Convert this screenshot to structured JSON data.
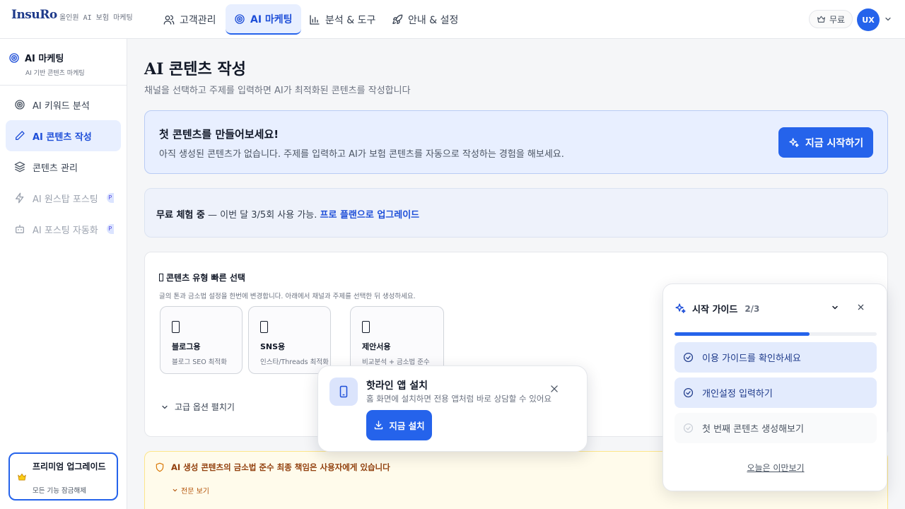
{
  "header": {
    "brand": "InsuRo",
    "brand_sub": "올인원 AI 보험 마케팅",
    "nav": [
      {
        "label": "고객관리"
      },
      {
        "label": "AI 마케팅"
      },
      {
        "label": "분석 & 도구"
      },
      {
        "label": "안내 & 설정"
      }
    ],
    "plan_label": "무료",
    "avatar_initials": "UX"
  },
  "sidebar": {
    "title": "AI 마케팅",
    "subtitle": "AI 기반 콘텐츠 마케팅",
    "items": [
      {
        "label": "AI 키워드 분석"
      },
      {
        "label": "AI 콘텐츠 작성"
      },
      {
        "label": "콘텐츠 관리"
      },
      {
        "label": "AI 원스탑 포스팅",
        "badge": "P"
      },
      {
        "label": "AI 포스팅 자동화",
        "badge": "P"
      }
    ],
    "upgrade": {
      "title": "프리미엄 업그레이드",
      "subtitle": "모든 기능 잠금해제"
    }
  },
  "main": {
    "title_ai": "AI",
    "title_rest": " 콘텐츠 작성",
    "subtitle": "채널을 선택하고 주제를 입력하면 AI가 최적화된 콘텐츠를 작성합니다",
    "hero": {
      "title": "첫 콘텐츠를 만들어보세요!",
      "desc": "아직 생성된 콘텐츠가 없습니다. 주제를 입력하고 AI가 보험 콘텐츠를 자동으로 작성하는 경험을 해보세요.",
      "button": "지금 시작하기"
    },
    "trial": {
      "bold": "무료 체험 중",
      "text": " — 이번 달 3/5회 사용 가능. ",
      "link": "프로 플랜으로 업그레이드"
    },
    "content_type": {
      "title": "콘텐츠 유형 빠른 선택",
      "desc": "글의 톤과 금소법 설정을 한번에 변경합니다. 아래에서 채널과 주제를 선택한 뒤 생성하세요.",
      "cards": [
        {
          "name": "블로그용",
          "desc": "블로그 SEO 최적화"
        },
        {
          "name": "SNS용",
          "desc": "인스타/Threads 최적화"
        },
        {
          "name": "제안서용",
          "desc": "비교분석 + 금소법 준수"
        }
      ],
      "advanced": "고급 옵션 펼치기"
    },
    "warning": {
      "text": "AI 생성 콘텐츠의 금소법 준수 최종 책임은 사용자에게 있습니다",
      "more": "전문 보기"
    }
  },
  "install_popup": {
    "title": "핫라인 앱 설치",
    "desc": "홈 화면에 설치하면 전용 앱처럼 바로 상담할 수 있어요",
    "button": "지금 설치"
  },
  "guide": {
    "title": "시작 가이드",
    "step": "2/3",
    "progress": 0.667,
    "items": [
      {
        "label": "이용 가이드를 확인하세요",
        "done": true
      },
      {
        "label": "개인설정 입력하기",
        "done": true
      },
      {
        "label": "첫 번째 콘텐츠 생성해보기",
        "done": false
      }
    ],
    "later": "오늘은 이만보기"
  },
  "colors": {
    "accent": "#2563eb",
    "accent_light": "#e8efff",
    "warning": "#92400e"
  },
  "icons": [
    "users-icon",
    "target-icon",
    "bar-chart-icon",
    "rocket-icon",
    "crown-icon",
    "pen-icon",
    "layers-icon",
    "zap-icon",
    "bot-icon",
    "sparkles-icon",
    "shield-icon",
    "smartphone-icon",
    "download-icon",
    "check-circle-icon",
    "chevron-down-icon",
    "close-icon"
  ]
}
